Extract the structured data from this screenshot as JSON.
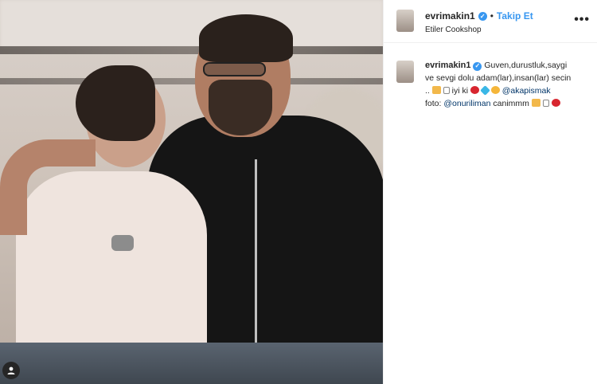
{
  "post": {
    "username": "evrimakin1",
    "follow_label": "Takip Et",
    "dot": "•",
    "location": "Etiler Cookshop",
    "more": "•••"
  },
  "caption": {
    "username": "evrimakin1",
    "line1": "Guven,durustluk,saygi",
    "line2": "ve sevgi dolu adam(lar),insan(lar) secin",
    "line3a": "..",
    "line3b": "iyi ki",
    "mention1": "@akapismak",
    "line4a": "foto:",
    "mention2": "@onuriliman",
    "line4b": "canimmm"
  },
  "icons": {
    "verified": "verified-badge-icon",
    "more": "more-options-icon",
    "user": "user-tag-icon"
  },
  "colors": {
    "accent": "#3897f0",
    "mention": "#003569"
  }
}
